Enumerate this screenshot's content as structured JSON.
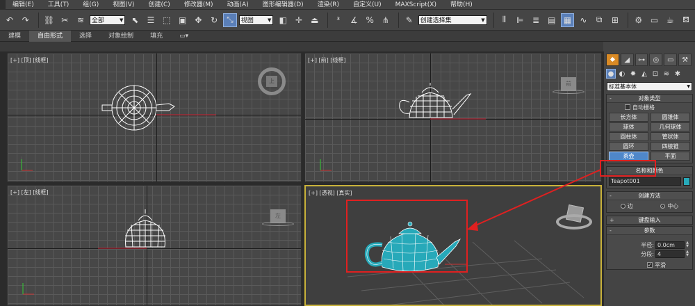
{
  "menu": [
    "编辑(E)",
    "工具(T)",
    "组(G)",
    "视图(V)",
    "创建(C)",
    "修改器(M)",
    "动画(A)",
    "图形编辑器(D)",
    "渲染(R)",
    "自定义(U)",
    "MAXScript(X)",
    "帮助(H)"
  ],
  "toolbar": {
    "selection_filter": "全部",
    "ref_coord": "视图",
    "named_selection": "创建选择集"
  },
  "ribbon_tabs": [
    "建模",
    "自由形式",
    "选择",
    "对象绘制",
    "填充"
  ],
  "ribbon_selected": 1,
  "viewports": {
    "top": "[+] [顶] [线框]",
    "front": "[+] [前] [线框]",
    "left": "[+] [左] [线框]",
    "persp": "[+] [透视] [真实]"
  },
  "cube_labels": {
    "top": "上",
    "front": "前",
    "left": "左"
  },
  "command_panel": {
    "category": "标准基本体",
    "object_type": {
      "title": "对象类型",
      "autogrid": "自动栅格",
      "buttons": [
        "长方体",
        "圆锥体",
        "球体",
        "几何球体",
        "圆柱体",
        "管状体",
        "圆环",
        "四棱锥",
        "茶壶",
        "平面"
      ],
      "selected": "茶壶"
    },
    "name_color": {
      "title": "名称和颜色",
      "name": "Teapot001",
      "color": "#27a9b9"
    },
    "creation_method": {
      "title": "创建方法",
      "options": [
        "边",
        "中心"
      ],
      "selected": "中心"
    },
    "keyboard_entry": "键盘输入",
    "parameters": {
      "title": "参数",
      "radius_label": "半径:",
      "radius": "0.0cm",
      "segments_label": "分段:",
      "segments": "4",
      "smooth_label": "平滑"
    }
  },
  "colors": {
    "accent": "#d98a25",
    "selected_button": "#4f87c9",
    "viewport_active_border": "#c9b23a",
    "annotation_red": "#e02020",
    "teapot": "#27a9b9"
  }
}
